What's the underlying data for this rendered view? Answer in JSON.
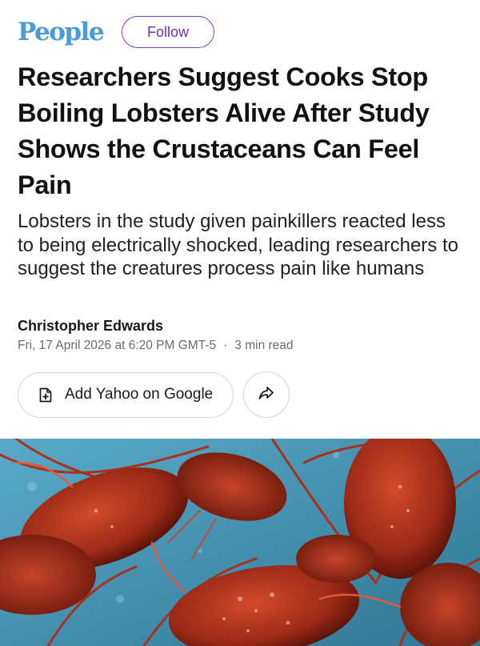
{
  "header": {
    "logo_text": "People",
    "follow_label": "Follow"
  },
  "article": {
    "headline": "Researchers Suggest Cooks Stop Boiling Lobsters Alive After Study Shows the Crustaceans Can Feel Pain",
    "dek": "Lobsters in the study given painkillers reacted less to being electrically shocked, leading researchers to suggest the creatures process pain like humans",
    "author": "Christopher Edwards",
    "date": "Fri, 17 April 2026 at 6:20 PM GMT-5",
    "separator": "·",
    "read_time": "3 min read"
  },
  "actions": {
    "add_label": "Add Yahoo on Google",
    "add_icon": "add-document-icon",
    "share_icon": "share-arrow-icon"
  },
  "colors": {
    "brand": "#4a9bdc",
    "follow_accent": "#6c2fb8",
    "water": "#3f8fb0",
    "lobster": "#b3361f"
  }
}
